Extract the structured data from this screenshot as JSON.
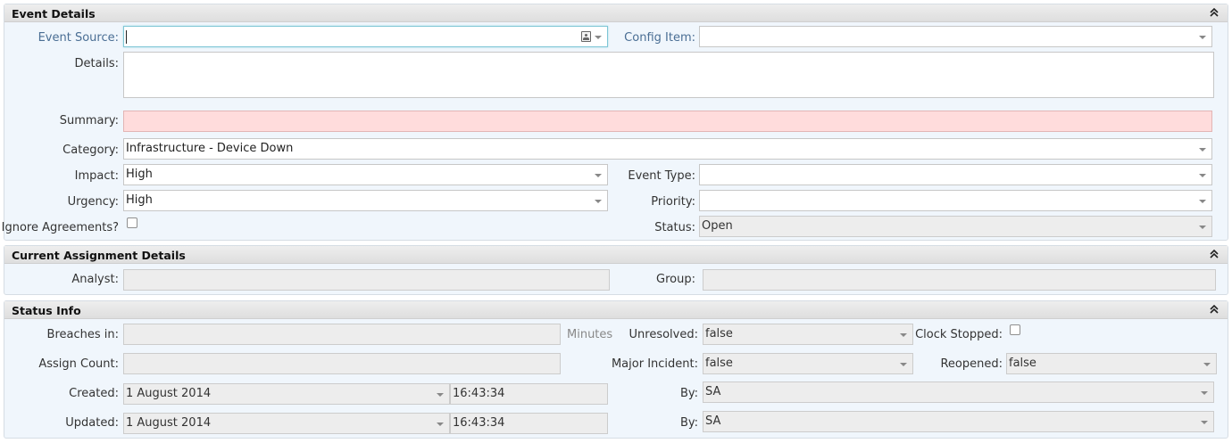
{
  "event_details": {
    "title": "Event Details",
    "event_source": {
      "label": "Event Source:",
      "value": ""
    },
    "config_item": {
      "label": "Config Item:",
      "value": ""
    },
    "details": {
      "label": "Details:",
      "value": ""
    },
    "summary": {
      "label": "Summary:",
      "value": ""
    },
    "category": {
      "label": "Category:",
      "value": "Infrastructure - Device Down"
    },
    "impact": {
      "label": "Impact:",
      "value": "High"
    },
    "event_type": {
      "label": "Event Type:",
      "value": ""
    },
    "urgency": {
      "label": "Urgency:",
      "value": "High"
    },
    "priority": {
      "label": "Priority:",
      "value": ""
    },
    "ignore_agreements": {
      "label": "Ignore Agreements?",
      "checked": false
    },
    "status": {
      "label": "Status:",
      "value": "Open"
    }
  },
  "assignment": {
    "title": "Current Assignment Details",
    "analyst": {
      "label": "Analyst:",
      "value": ""
    },
    "group": {
      "label": "Group:",
      "value": ""
    }
  },
  "status_info": {
    "title": "Status Info",
    "breaches_in": {
      "label": "Breaches in:",
      "value": "",
      "unit": "Minutes"
    },
    "unresolved": {
      "label": "Unresolved:",
      "value": "false"
    },
    "clock_stopped": {
      "label": "Clock Stopped:",
      "checked": false
    },
    "assign_count": {
      "label": "Assign Count:",
      "value": ""
    },
    "major_incident": {
      "label": "Major Incident:",
      "value": "false"
    },
    "reopened": {
      "label": "Reopened:",
      "value": "false"
    },
    "created": {
      "label": "Created:",
      "date": "1 August 2014",
      "time": "16:43:34",
      "by_label": "By:",
      "by": "SA"
    },
    "updated": {
      "label": "Updated:",
      "date": "1 August 2014",
      "time": "16:43:34",
      "by_label": "By:",
      "by": "SA"
    }
  }
}
